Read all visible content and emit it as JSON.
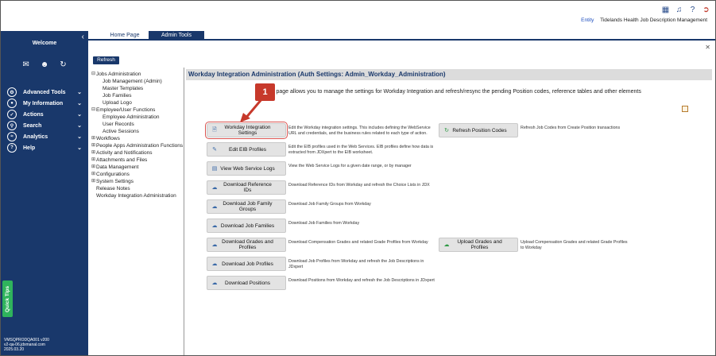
{
  "header": {
    "entity_label": "Entity",
    "entity_name": "Tidelands Health Job Description Management",
    "icons": [
      "sitemap-icon",
      "bell-icon",
      "help-icon",
      "logout-icon"
    ]
  },
  "sidebar": {
    "welcome": "Welcome",
    "icons": [
      "mail-icon",
      "users-icon",
      "sync-icon"
    ],
    "items": [
      {
        "label": "Advanced Tools",
        "icon": "tools-icon"
      },
      {
        "label": "My Information",
        "icon": "user-icon"
      },
      {
        "label": "Actions",
        "icon": "actions-icon"
      },
      {
        "label": "Search",
        "icon": "search-icon"
      },
      {
        "label": "Analytics",
        "icon": "analytics-icon"
      },
      {
        "label": "Help",
        "icon": "help-icon"
      }
    ],
    "quick_tips": "Quick Tips",
    "version_line1": "VMSQPRODQA001 v200",
    "version_line2": "v2-qa-06.jdxmanal.com",
    "version_line3": "2025.03.20"
  },
  "tabs": {
    "home": "Home Page",
    "admin": "Admin Tools"
  },
  "refresh_label": "Refresh",
  "tree": {
    "items": [
      {
        "label": "Jobs Administration",
        "type": "group",
        "toggle": "⊟"
      },
      {
        "label": "Job Management (Admin)",
        "type": "child"
      },
      {
        "label": "Master Templates",
        "type": "child"
      },
      {
        "label": "Job Families",
        "type": "child"
      },
      {
        "label": "Upload Logo",
        "type": "child"
      },
      {
        "label": "Employee/User Functions",
        "type": "group",
        "toggle": "⊟"
      },
      {
        "label": "Employee Administration",
        "type": "child"
      },
      {
        "label": "User Records",
        "type": "child"
      },
      {
        "label": "Active Sessions",
        "type": "child"
      },
      {
        "label": "Workflows",
        "type": "group",
        "toggle": "⊞"
      },
      {
        "label": "People Apps Administration Functions",
        "type": "group",
        "toggle": "⊞"
      },
      {
        "label": "Activity and Notifications",
        "type": "group",
        "toggle": "⊞"
      },
      {
        "label": "Attachments and Files",
        "type": "group",
        "toggle": "⊞"
      },
      {
        "label": "Data Management",
        "type": "group",
        "toggle": "⊞"
      },
      {
        "label": "Configurations",
        "type": "group",
        "toggle": "⊞"
      },
      {
        "label": "System Settings",
        "type": "group",
        "toggle": "⊞"
      },
      {
        "label": "Release Notes",
        "type": "plain"
      },
      {
        "label": "Workday Integration Administration",
        "type": "plain"
      }
    ]
  },
  "main": {
    "title": "Workday Integration Administration (Auth Settings: Admin_Workday_Administration)",
    "intro": "s page allows you to manage the settings for Workday Integration and refresh/resync the pending Position codes, reference tables and other elements",
    "callout_number": "1",
    "left_buttons": [
      {
        "label": "Workday Integration Settings",
        "icon": "settings-doc-icon",
        "desc": "Edit the Workday integration settings. This includes defining the WebService URL and credentials, and the business rules related to each type of action."
      },
      {
        "label": "Edit EIB Profiles",
        "icon": "pencil-icon",
        "desc": "Edit the EIB profiles used in the Web Services. EIB profiles define how data is extracted from JDXpert to the EIB worksheet."
      },
      {
        "label": "View Web Service Logs",
        "icon": "log-icon",
        "desc": "View the Web Service Logs for a given date range, or by manager"
      },
      {
        "label": "Download Reference IDs",
        "icon": "cloud-download-icon",
        "desc": "Download Reference IDs from Workday and refresh the Choice Lists in JDX"
      },
      {
        "label": "Download Job Family Groups",
        "icon": "cloud-download-icon",
        "desc": "Download Job Family Groups from Workday"
      },
      {
        "label": "Download Job Families",
        "icon": "cloud-download-icon",
        "desc": "Download Job Families from Workday"
      },
      {
        "label": "Download Grades and Profiles",
        "icon": "cloud-download-icon",
        "desc": "Download Compensation Grades and related Grade Profiles from Workday"
      },
      {
        "label": "Download Job Profiles",
        "icon": "cloud-download-icon",
        "desc": "Download Job Profiles from Workday and refresh the Job Descriptions in JDxpert"
      },
      {
        "label": "Download Positions",
        "icon": "cloud-download-icon",
        "desc": "Download Positions from Workday and refresh the Job Descriptions in JDxpert"
      }
    ],
    "right_buttons": [
      {
        "label": "Refresh Position Codes",
        "icon": "refresh-icon",
        "desc": "Refresh Job Codes from Create Position transactions"
      },
      {
        "label": "Upload Grades and Profiles",
        "icon": "cloud-upload-icon",
        "desc": "Upload Compensation Grades and related Grade Profiles to Workday"
      }
    ]
  }
}
